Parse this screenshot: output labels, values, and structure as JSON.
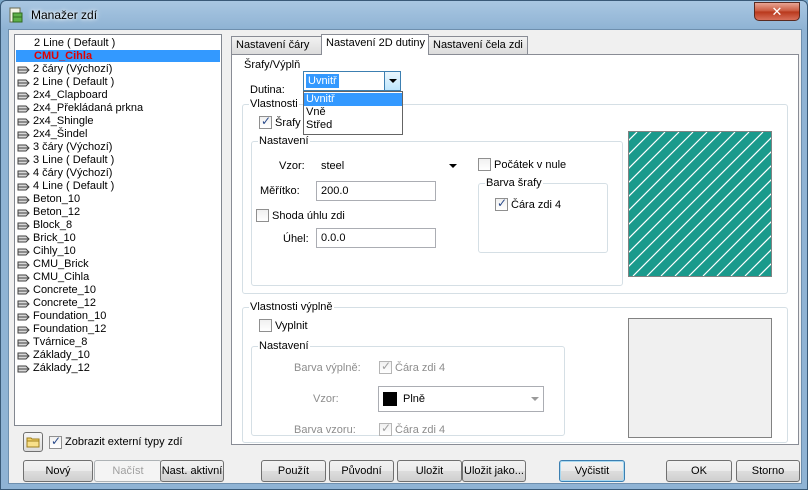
{
  "window": {
    "title": "Manažer zdí",
    "close_glyph": "✕"
  },
  "tree": {
    "items": [
      {
        "label": "2 Line ( Default )",
        "icon": "none"
      },
      {
        "label": "CMU_Cihla",
        "icon": "none",
        "selected": true
      },
      {
        "label": "2 čáry (Výchozí)",
        "icon": "wall-type-icon"
      },
      {
        "label": "2 Line ( Default )",
        "icon": "wall-type-icon"
      },
      {
        "label": "2x4_Clapboard",
        "icon": "wall-type-icon"
      },
      {
        "label": "2x4_Překládaná prkna",
        "icon": "wall-type-icon"
      },
      {
        "label": "2x4_Shingle",
        "icon": "wall-type-icon"
      },
      {
        "label": "2x4_Šindel",
        "icon": "wall-type-icon"
      },
      {
        "label": "3 čáry (Výchozí)",
        "icon": "wall-type-icon"
      },
      {
        "label": "3 Line ( Default )",
        "icon": "wall-type-icon"
      },
      {
        "label": "4 čáry (Výchozí)",
        "icon": "wall-type-icon"
      },
      {
        "label": "4 Line ( Default )",
        "icon": "wall-type-icon"
      },
      {
        "label": "Beton_10",
        "icon": "wall-type-icon"
      },
      {
        "label": "Beton_12",
        "icon": "wall-type-icon"
      },
      {
        "label": "Block_8",
        "icon": "wall-type-icon"
      },
      {
        "label": "Brick_10",
        "icon": "wall-type-icon"
      },
      {
        "label": "Cihly_10",
        "icon": "wall-type-icon"
      },
      {
        "label": "CMU_Brick",
        "icon": "wall-type-icon"
      },
      {
        "label": "CMU_Cihla",
        "icon": "wall-type-icon"
      },
      {
        "label": "Concrete_10",
        "icon": "wall-type-icon"
      },
      {
        "label": "Concrete_12",
        "icon": "wall-type-icon"
      },
      {
        "label": "Foundation_10",
        "icon": "wall-type-icon"
      },
      {
        "label": "Foundation_12",
        "icon": "wall-type-icon"
      },
      {
        "label": "Tvárnice_8",
        "icon": "wall-type-icon"
      },
      {
        "label": "Základy_10",
        "icon": "wall-type-icon"
      },
      {
        "label": "Základy_12",
        "icon": "wall-type-icon"
      }
    ],
    "show_external_label": "Zobrazit externí typy zdí",
    "show_external_checked": true
  },
  "tabs": [
    {
      "label": "Nastavení čáry",
      "active": false
    },
    {
      "label": "Nastavení 2D dutiny",
      "active": true
    },
    {
      "label": "Nastavení čela zdi",
      "active": false
    }
  ],
  "hatch": {
    "group_title": "Šrafy/Výplň",
    "cavity_label": "Dutina:",
    "cavity_value": "Uvnitř",
    "cavity_options": [
      "Uvnitř",
      "Vně",
      "Střed"
    ],
    "props_title": "Vlastnosti",
    "hatch_checkbox_label": "Šrafy",
    "settings_title": "Nastavení",
    "pattern_label": "Vzor:",
    "pattern_value": "steel",
    "origin_label": "Počátek v nule",
    "scale_label": "Měřítko:",
    "scale_value": "200.0",
    "match_angle_label": "Shoda úhlu zdi",
    "angle_label": "Úhel:",
    "angle_value": "0.0.0",
    "color_title": "Barva šrafy",
    "color_checkbox_label": "Čára zdi 4",
    "preview_bg": "#1a9a8c"
  },
  "fill": {
    "group_title": "Vlastnosti výplně",
    "fill_checkbox_label": "Vyplnit",
    "settings_title": "Nastavení",
    "fill_color_label": "Barva výplně:",
    "fill_color_value": "Čára zdi 4",
    "pattern_label": "Vzor:",
    "pattern_value": "Plně",
    "pattern_color_label": "Barva vzoru:",
    "pattern_color_value": "Čára zdi 4"
  },
  "buttons": {
    "new": "Nový",
    "load": "Načíst",
    "set_active": "Nast. aktivní",
    "apply": "Použít",
    "original": "Původní",
    "save": "Uložit",
    "save_as": "Uložit jako...",
    "clean": "Vyčistit",
    "ok": "OK",
    "cancel": "Storno"
  }
}
